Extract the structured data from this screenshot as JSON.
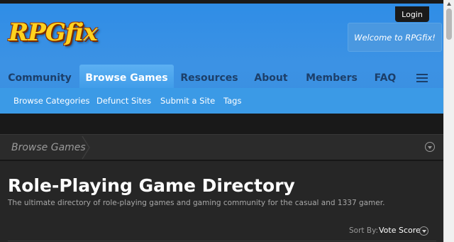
{
  "header": {
    "login_label": "Login",
    "logo_text": "RPGfix",
    "welcome_text": "Welcome to RPGfix!"
  },
  "nav": {
    "items": [
      {
        "label": "Community"
      },
      {
        "label": "Browse Games"
      },
      {
        "label": "Resources"
      },
      {
        "label": "About"
      },
      {
        "label": "Members"
      },
      {
        "label": "FAQ"
      }
    ],
    "active": "Browse Games",
    "menu_icon": "hamburger-icon"
  },
  "subnav": {
    "items": [
      {
        "label": "Browse Categories"
      },
      {
        "label": "Defunct Sites"
      },
      {
        "label": "Submit a Site"
      },
      {
        "label": "Tags"
      }
    ]
  },
  "breadcrumb": {
    "label": "Browse Games",
    "collapse_icon": "chevron-down-circle-icon"
  },
  "main": {
    "title": "Role-Playing Game Directory",
    "description": "The ultimate directory of role-playing games and gaming community for the casual and 1337 gamer.",
    "sort_label": "Sort By:",
    "sort_value": "Vote Score"
  },
  "colors": {
    "header_blue": "#3c92e4",
    "active_tab": "#4aa5ee",
    "nav_text": "#1c3f6a",
    "subnav_bg": "#3b9ae6",
    "page_bg": "#191919",
    "content_bg": "#262626"
  }
}
